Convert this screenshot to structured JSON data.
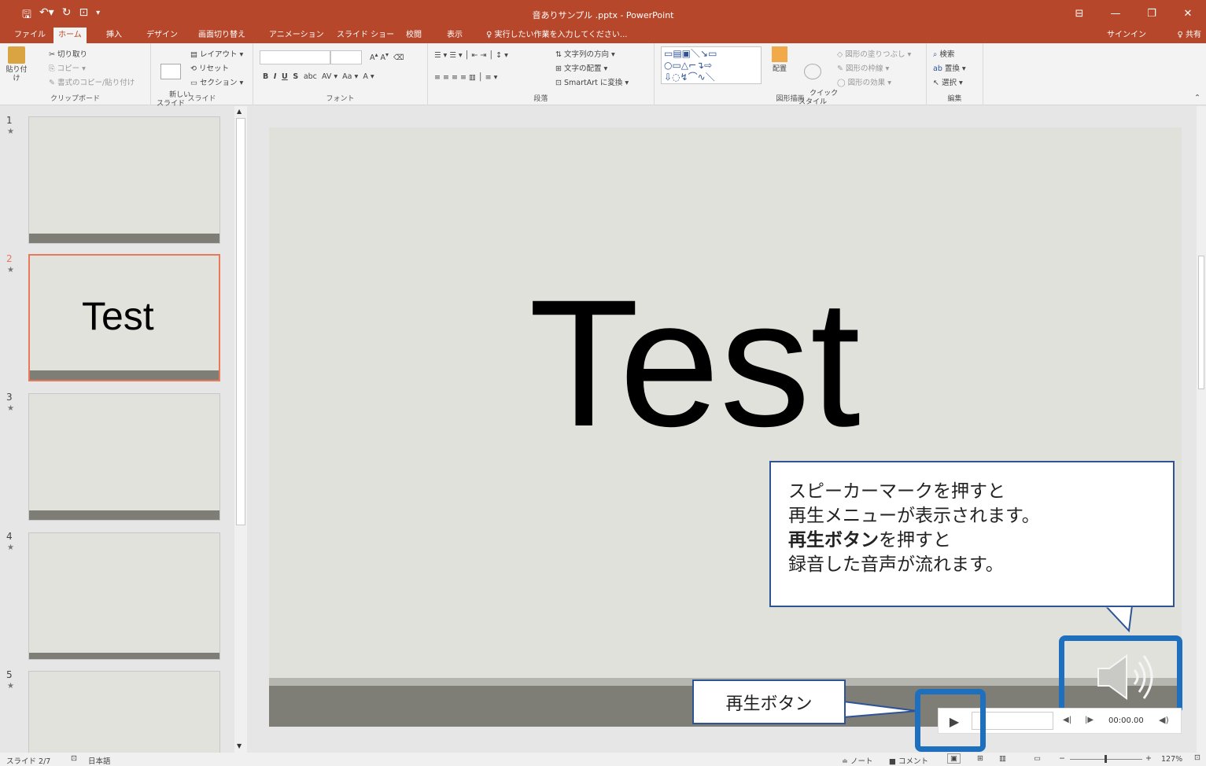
{
  "app": {
    "title": "音ありサンプル .pptx - PowerPoint"
  },
  "tabs": [
    "ファイル",
    "ホーム",
    "挿入",
    "デザイン",
    "画面切り替え",
    "アニメーション",
    "スライド ショー",
    "校閲",
    "表示"
  ],
  "tell_me": "♀ 実行したい作業を入力してください...",
  "account": {
    "signin": "サインイン",
    "share": "♀ 共有"
  },
  "ribbon": {
    "clipboard": {
      "paste": "貼り付け",
      "cut": "切り取り",
      "copy": "コピー",
      "format_painter": "書式のコピー/貼り付け",
      "label": "クリップボード"
    },
    "slides": {
      "new_slide": "新しい\nスライド",
      "layout": "レイアウト",
      "reset": "リセット",
      "section": "セクション",
      "label": "スライド"
    },
    "font": {
      "label": "フォント",
      "aa": "Aa"
    },
    "paragraph": {
      "text_direction": "文字列の方向",
      "align_text": "文字の配置",
      "smartart": "SmartArt に変換",
      "label": "段落"
    },
    "drawing": {
      "arrange": "配置",
      "quick_styles": "クイック\nスタイル",
      "fill": "図形の塗りつぶし",
      "outline": "図形の枠線",
      "effects": "図形の効果",
      "label": "図形描画"
    },
    "editing": {
      "find": "検索",
      "replace": "置換",
      "select": "選択",
      "label": "編集"
    }
  },
  "thumbnails": [
    {
      "num": "1",
      "text": ""
    },
    {
      "num": "2",
      "text": "Test"
    },
    {
      "num": "3",
      "text": ""
    },
    {
      "num": "4",
      "text": ""
    },
    {
      "num": "5",
      "text": ""
    }
  ],
  "slide": {
    "text": "Test"
  },
  "callout": {
    "line1": "スピーカーマークを押すと",
    "line2": "再生メニューが表示されます。",
    "line3_bold": "再生ボタン",
    "line3_rest": "を押すと",
    "line4": "録音した音声が流れます。"
  },
  "play_label": "再生ボタン",
  "player": {
    "time": "00:00.00"
  },
  "status": {
    "slide": "スライド 2/7",
    "language": "日本語",
    "notes": "≐ ノート",
    "comments": "コメント",
    "zoom": "127%"
  },
  "colors": {
    "accent": "#b7472a",
    "callout_border": "#2f5496",
    "highlight": "#1f6fbf"
  }
}
